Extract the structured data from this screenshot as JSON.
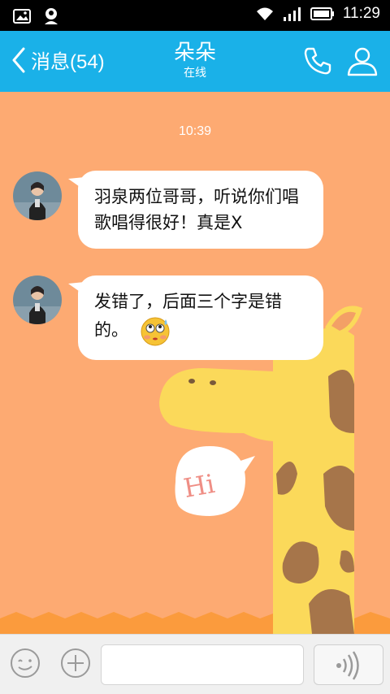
{
  "status_bar": {
    "time": "11:29"
  },
  "header": {
    "back_label": "消息(54)",
    "title": "朵朵",
    "subtitle": "在线"
  },
  "chat": {
    "timestamp": "10:39",
    "messages": [
      {
        "text": "羽泉两位哥哥，听说你们唱歌唱得很好！真是X"
      },
      {
        "text": "发错了，后面三个字是错的。"
      }
    ],
    "sticker_text": "Hi"
  },
  "colors": {
    "header": "#1ab1e8",
    "chat_bg": "#fdaa72",
    "giraffe": "#fbd95a",
    "spots": "#a6754a"
  },
  "icons": [
    "back-chevron-icon",
    "phone-icon",
    "profile-icon",
    "emoji-icon",
    "plus-icon",
    "voice-icon"
  ]
}
